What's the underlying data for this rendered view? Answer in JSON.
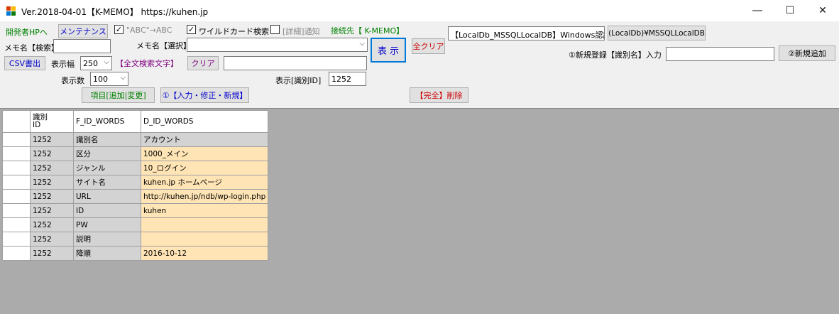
{
  "window": {
    "title": "Ver.2018-04-01【K-MEMO】 https://kuhen.jp",
    "minimize": "―",
    "maximize": "☐",
    "close": "✕"
  },
  "toolbar": {
    "dev_link": "開発者HPへ",
    "maintenance_btn": "メンテナンス",
    "abc_label": "\"ABC\"→ABC",
    "abc_checked": true,
    "wildcard_label": "ワイルドカード検索",
    "wildcard_checked": true,
    "detail_label": "[詳細]通知",
    "detail_checked": false,
    "connection_label": "接続先【 K-MEMO】",
    "db_combo": "【LocalDb_MSSQLLocalDB】Windows認証",
    "db_server_btn": "(LocalDb)¥MSSQLLocalDB",
    "memo_search_label": "メモ名【検索】",
    "memo_search_value": "",
    "memo_select_label": "メモ名【選択】",
    "memo_select_value": "",
    "show_btn": "表 示",
    "clear_all_btn": "全クリア",
    "new_register_label": "①新規登録【識別名】入力",
    "new_register_value": "",
    "new_add_btn": "②新規追加",
    "csv_btn": "CSV書出",
    "width_label": "表示幅",
    "width_value": "250",
    "fulltext_label": "【全文検索文字】",
    "clear_btn": "クリア",
    "fulltext_value": "",
    "count_label": "表示数",
    "count_value": "100",
    "id_label": "表示[識別ID]",
    "id_value": "1252",
    "item_btn": "項目[追加|変更]",
    "input_btn": "①【入力・修正・新規】",
    "delete_btn": "【完全】削除"
  },
  "grid": {
    "headers": [
      "識別\nID",
      "F_ID_WORDS",
      "D_ID_WORDS"
    ],
    "rows": [
      [
        "1252",
        "識別名",
        "アカウント"
      ],
      [
        "1252",
        "区分",
        "1000_メイン"
      ],
      [
        "1252",
        "ジャンル",
        "10_ログイン"
      ],
      [
        "1252",
        "サイト名",
        "kuhen.jp ホームページ"
      ],
      [
        "1252",
        "URL",
        "http://kuhen.jp/ndb/wp-login.php"
      ],
      [
        "1252",
        "ID",
        "kuhen"
      ],
      [
        "1252",
        "PW",
        ""
      ],
      [
        "1252",
        "説明",
        ""
      ],
      [
        "1252",
        "降順",
        "2016-10-12"
      ]
    ]
  },
  "colors": {
    "link_green": "#008000",
    "purple": "#800080",
    "blue": "#0000cc",
    "red": "#cc0000",
    "value_cell": "#ffe4b5",
    "key_cell": "#d3d3d3",
    "grid_bg": "#ababab"
  }
}
